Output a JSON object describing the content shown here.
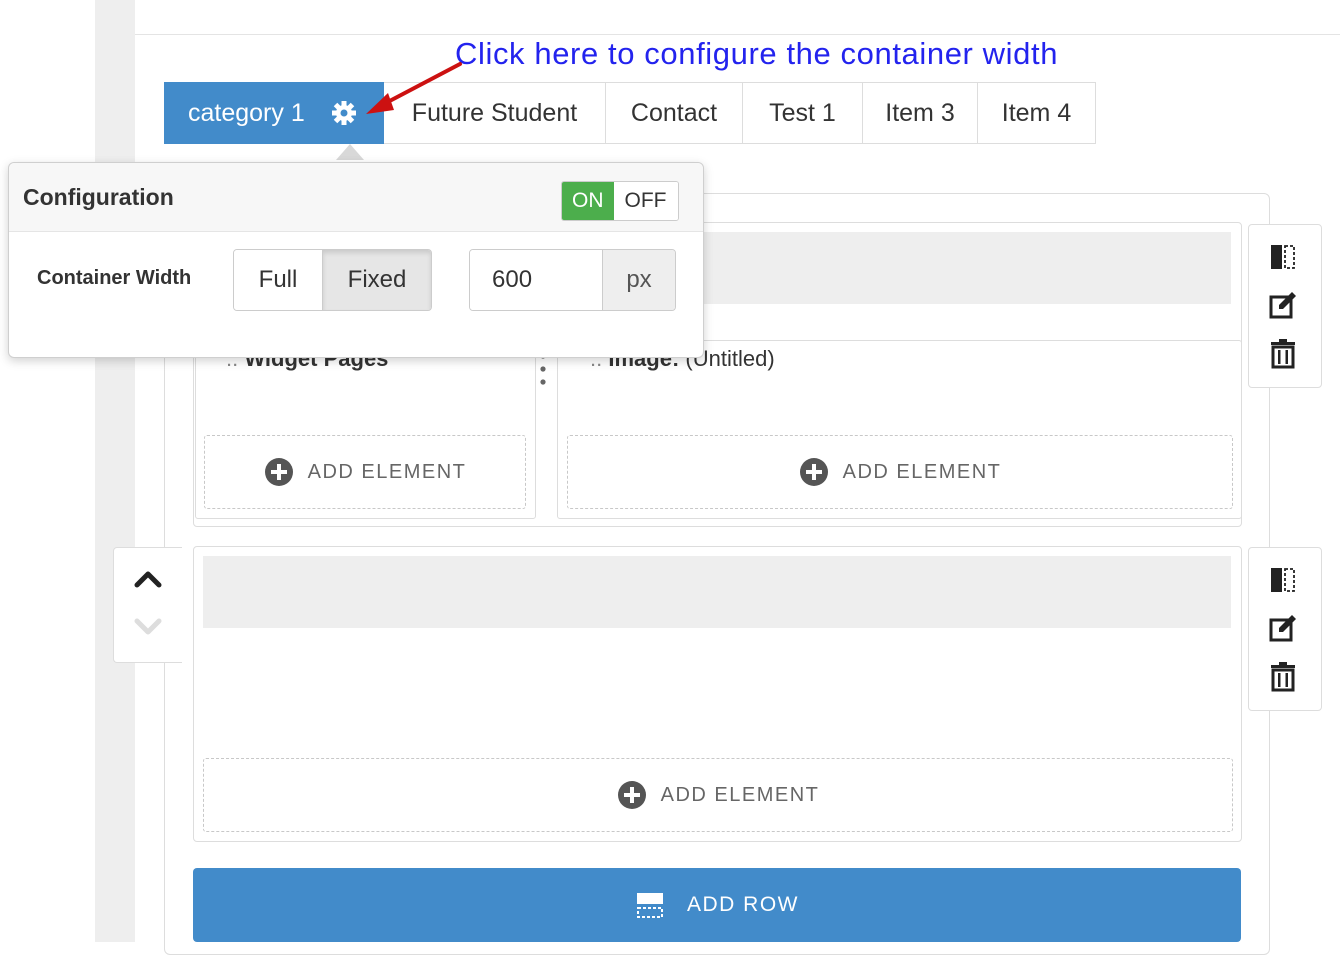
{
  "annotation": {
    "text": "Click here to configure the container width"
  },
  "tabs": [
    {
      "label": "category 1",
      "active": true
    },
    {
      "label": "Future Student"
    },
    {
      "label": "Contact"
    },
    {
      "label": "Test 1"
    },
    {
      "label": "Item 3"
    },
    {
      "label": "Item 4"
    }
  ],
  "config": {
    "title": "Configuration",
    "toggle_on": "ON",
    "toggle_off": "OFF",
    "toggle_state": "ON",
    "width_label": "Container Width",
    "width_options": [
      "Full",
      "Fixed"
    ],
    "width_selected": "Fixed",
    "width_value": "600",
    "width_unit": "px"
  },
  "row1": {
    "col1_prefix": "::",
    "col1_title": "Widget Pages",
    "col2_prefix": "::",
    "col2_title": "Image:",
    "col2_subtitle": "(Untitled)",
    "add_element": "ADD ELEMENT"
  },
  "row2": {
    "add_element": "ADD ELEMENT"
  },
  "add_row_label": "ADD ROW",
  "icons": {
    "tab_settings": "gear-icon",
    "row_tools": [
      "columns-icon",
      "edit-icon",
      "trash-icon"
    ],
    "mover": [
      "chevron-up-icon",
      "chevron-down-icon"
    ],
    "add_element": "plus-circle-icon",
    "add_row": "add-row-icon"
  },
  "colors": {
    "primary": "#428bca",
    "toggle_on": "#4cae4c",
    "annotation": "#2323ee",
    "arrow": "#cc1111"
  }
}
